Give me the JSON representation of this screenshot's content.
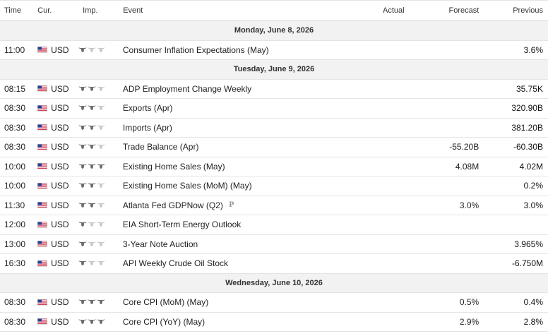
{
  "columns": {
    "time": "Time",
    "currency": "Cur.",
    "importance": "Imp.",
    "event": "Event",
    "actual": "Actual",
    "forecast": "Forecast",
    "previous": "Previous"
  },
  "colors": {
    "bull_active": "#6b6b6b",
    "bull_inactive": "#c8c8c8",
    "day_bg": "#f2f2f2",
    "border": "#e4e4e4"
  },
  "rows": [
    {
      "type": "day",
      "label": "Monday, June 8, 2026"
    },
    {
      "type": "event",
      "time": "11:00",
      "currency": "USD",
      "importance": 1,
      "event": "Consumer Inflation Expectations (May)",
      "actual": "",
      "forecast": "",
      "previous": "3.6%"
    },
    {
      "type": "day",
      "label": "Tuesday, June 9, 2026"
    },
    {
      "type": "event",
      "time": "08:15",
      "currency": "USD",
      "importance": 2,
      "event": "ADP Employment Change Weekly",
      "actual": "",
      "forecast": "",
      "previous": "35.75K"
    },
    {
      "type": "event",
      "time": "08:30",
      "currency": "USD",
      "importance": 2,
      "event": "Exports (Apr)",
      "actual": "",
      "forecast": "",
      "previous": "320.90B"
    },
    {
      "type": "event",
      "time": "08:30",
      "currency": "USD",
      "importance": 2,
      "event": "Imports (Apr)",
      "actual": "",
      "forecast": "",
      "previous": "381.20B"
    },
    {
      "type": "event",
      "time": "08:30",
      "currency": "USD",
      "importance": 2,
      "event": "Trade Balance (Apr)",
      "actual": "",
      "forecast": "-55.20B",
      "previous": "-60.30B"
    },
    {
      "type": "event",
      "time": "10:00",
      "currency": "USD",
      "importance": 3,
      "event": "Existing Home Sales (May)",
      "actual": "",
      "forecast": "4.08M",
      "previous": "4.02M"
    },
    {
      "type": "event",
      "time": "10:00",
      "currency": "USD",
      "importance": 2,
      "event": "Existing Home Sales (MoM) (May)",
      "actual": "",
      "forecast": "",
      "previous": "0.2%"
    },
    {
      "type": "event",
      "time": "11:30",
      "currency": "USD",
      "importance": 2,
      "event": "Atlanta Fed GDPNow (Q2)",
      "badge": "P",
      "actual": "",
      "forecast": "3.0%",
      "previous": "3.0%"
    },
    {
      "type": "event",
      "time": "12:00",
      "currency": "USD",
      "importance": 1,
      "event": "EIA Short-Term Energy Outlook",
      "actual": "",
      "forecast": "",
      "previous": ""
    },
    {
      "type": "event",
      "time": "13:00",
      "currency": "USD",
      "importance": 1,
      "event": "3-Year Note Auction",
      "actual": "",
      "forecast": "",
      "previous": "3.965%"
    },
    {
      "type": "event",
      "time": "16:30",
      "currency": "USD",
      "importance": 1,
      "event": "API Weekly Crude Oil Stock",
      "actual": "",
      "forecast": "",
      "previous": "-6.750M"
    },
    {
      "type": "day",
      "label": "Wednesday, June 10, 2026"
    },
    {
      "type": "event",
      "time": "08:30",
      "currency": "USD",
      "importance": 3,
      "event": "Core CPI (MoM) (May)",
      "actual": "",
      "forecast": "0.5%",
      "previous": "0.4%"
    },
    {
      "type": "event",
      "time": "08:30",
      "currency": "USD",
      "importance": 3,
      "event": "Core CPI (YoY) (May)",
      "actual": "",
      "forecast": "2.9%",
      "previous": "2.8%"
    }
  ]
}
